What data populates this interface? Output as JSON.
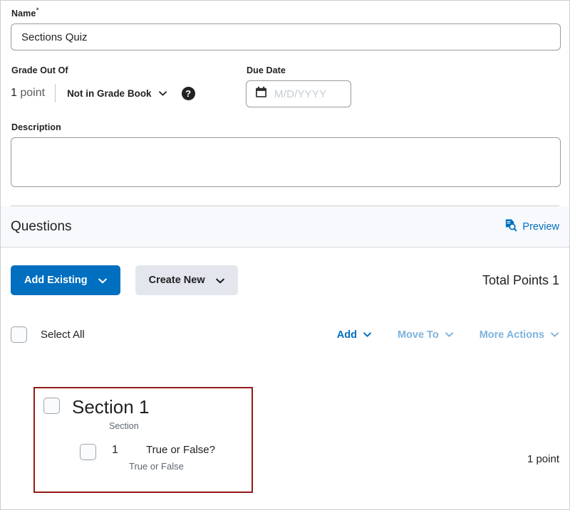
{
  "form": {
    "name": {
      "label": "Name",
      "required_marker": "*",
      "value": "Sections Quiz"
    },
    "grade_out_of": {
      "label": "Grade Out Of",
      "points_number": "1",
      "points_unit": "point",
      "grade_book_value": "Not in Grade Book",
      "help_glyph": "?",
      "help_icon_name": "help-circle-icon"
    },
    "due_date": {
      "label": "Due Date",
      "placeholder": "M/D/YYYY",
      "value": "",
      "calendar_icon_name": "calendar-icon"
    },
    "description": {
      "label": "Description",
      "value": ""
    }
  },
  "questions_panel": {
    "title": "Questions",
    "preview_label": "Preview",
    "preview_icon_name": "document-search-icon",
    "toolbar": {
      "add_existing_label": "Add Existing",
      "create_new_label": "Create New",
      "total_points_label": "Total Points 1"
    },
    "actions": {
      "select_all_label": "Select All",
      "items": [
        {
          "label": "Add",
          "disabled": false
        },
        {
          "label": "Move To",
          "disabled": true
        },
        {
          "label": "More Actions",
          "disabled": true
        }
      ]
    },
    "section": {
      "title": "Section 1",
      "type_label": "Section",
      "highlight_color": "#951818",
      "questions": [
        {
          "number": "1",
          "text": "True or False?",
          "type_label": "True or False",
          "points": "1 point"
        }
      ]
    }
  },
  "colors": {
    "primary_blue": "#006fbf",
    "disabled_blue": "#7fb3dd",
    "secondary_gray": "#e3e7ed",
    "panel_bg": "#f7f9fc",
    "highlight_red": "#951818"
  }
}
